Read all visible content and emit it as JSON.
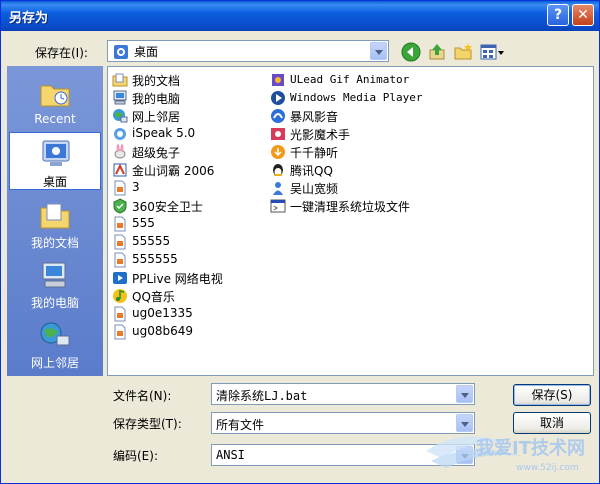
{
  "window": {
    "title": "另存为",
    "help_label": "?",
    "close_label": "✕"
  },
  "toolbar": {
    "save_in_label": "保存在(I):",
    "save_in_value": "桌面",
    "icons": [
      "back-icon",
      "up-folder-icon",
      "new-folder-icon",
      "view-menu-icon"
    ]
  },
  "places": [
    {
      "label": "Recent",
      "icon": "recent-folder-icon"
    },
    {
      "label": "桌面",
      "icon": "desktop-icon",
      "selected": true
    },
    {
      "label": "我的文档",
      "icon": "my-documents-icon"
    },
    {
      "label": "我的电脑",
      "icon": "my-computer-icon"
    },
    {
      "label": "网上邻居",
      "icon": "network-icon"
    }
  ],
  "files": {
    "column1": [
      {
        "name": "我的文档",
        "icon": "documents-icon"
      },
      {
        "name": "我的电脑",
        "icon": "computer-icon"
      },
      {
        "name": "网上邻居",
        "icon": "network-icon"
      },
      {
        "name": "iSpeak 5.0",
        "icon": "app-icon"
      },
      {
        "name": "超级兔子",
        "icon": "app-icon"
      },
      {
        "name": "金山词霸 2006",
        "icon": "app-icon"
      },
      {
        "name": "3",
        "icon": "file-icon"
      },
      {
        "name": "360安全卫士",
        "icon": "app-icon"
      },
      {
        "name": "555",
        "icon": "file-icon"
      },
      {
        "name": "55555",
        "icon": "file-icon"
      },
      {
        "name": "555555",
        "icon": "file-icon"
      },
      {
        "name": "PPLive 网络电视",
        "icon": "app-icon"
      },
      {
        "name": "QQ音乐",
        "icon": "app-icon"
      },
      {
        "name": "ug0e1335",
        "icon": "file-icon"
      },
      {
        "name": "ug08b649",
        "icon": "file-icon"
      }
    ],
    "column2": [
      {
        "name": "ULead Gif Animator",
        "icon": "shortcut-icon"
      },
      {
        "name": "Windows Media Player",
        "icon": "shortcut-icon"
      },
      {
        "name": "暴风影音",
        "icon": "shortcut-icon"
      },
      {
        "name": "光影魔术手",
        "icon": "shortcut-icon"
      },
      {
        "name": "千千静听",
        "icon": "shortcut-icon"
      },
      {
        "name": "腾讯QQ",
        "icon": "qq-icon"
      },
      {
        "name": "吴山宽频",
        "icon": "shortcut-icon"
      },
      {
        "name": "一键清理系统垃圾文件",
        "icon": "batch-file-icon"
      }
    ]
  },
  "form": {
    "filename_label": "文件名(N):",
    "filename_value": "清除系统LJ.bat",
    "filetype_label": "保存类型(T):",
    "filetype_value": "所有文件",
    "encoding_label": "编码(E):",
    "encoding_value": "ANSI",
    "save_button": "保存(S)",
    "cancel_button": "取消"
  },
  "watermark": {
    "text": "我爱IT技术网",
    "url": "www.52ij.com"
  },
  "colors": {
    "titlebar": "#0a4cc9",
    "dialog_bg": "#ece9d8",
    "places_bar": "#6b8bd0"
  }
}
